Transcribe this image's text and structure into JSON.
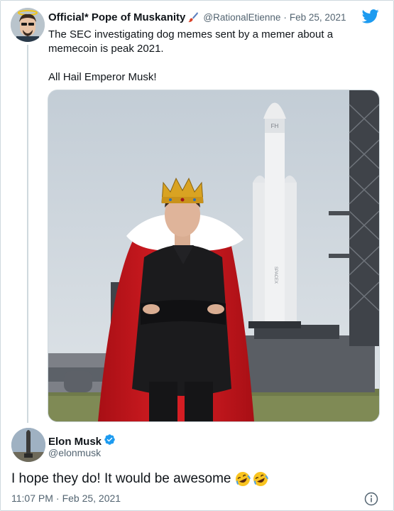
{
  "quoted_tweet": {
    "author_name": "Official* Pope of Muskanity",
    "author_handle": "@RationalEtienne",
    "separator": "·",
    "date": "Feb 25, 2021",
    "text_line1": "The SEC investigating dog memes sent by a memer about a memecoin is peak 2021.",
    "text_line2": "All Hail Emperor Musk!",
    "media": {
      "rocket_label": "FH",
      "rocket_side_text": "SPACEX"
    }
  },
  "reply": {
    "author_name": "Elon Musk",
    "author_handle": "@elonmusk",
    "text": "I hope they do! It would be awesome",
    "time": "11:07 PM",
    "separator": "·",
    "date": "Feb 25, 2021"
  },
  "icons": {
    "brand": "twitter-bird-icon",
    "verified": "verified-badge-icon",
    "emoji": "rolling-on-the-floor-laughing-emoji",
    "info": "info-icon",
    "author_badge": "paintbrush-icon"
  },
  "colors": {
    "twitter_blue": "#1d9bf0",
    "text_primary": "#0f1419",
    "text_secondary": "#536471",
    "border": "#cfd9de",
    "cape_red": "#c0141b"
  }
}
